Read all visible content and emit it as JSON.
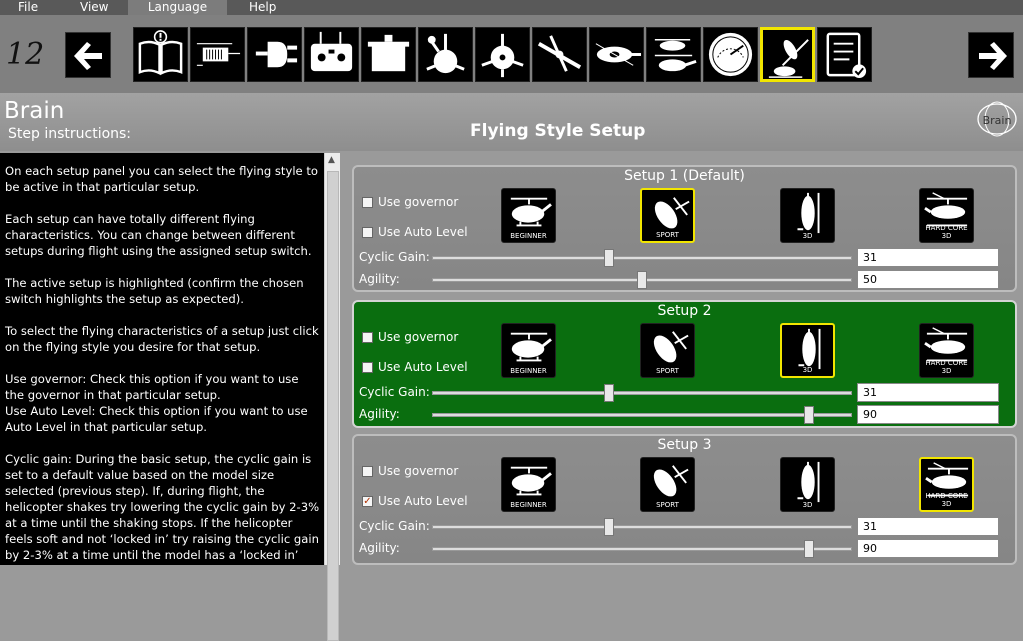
{
  "menu": [
    "File",
    "View",
    "Language",
    "Help"
  ],
  "menu_active": "Language",
  "toolbar": {
    "step_number": "12",
    "step_icons": [
      "manual-book-icon",
      "receiver-icon",
      "plug-icon",
      "transmitter-icon",
      "servo-icon",
      "swashplate-icon",
      "swashplate-level-icon",
      "rotor-blades-icon",
      "helicopter-top-icon",
      "helicopter-tilt-icon",
      "gauge-icon",
      "flying-style-icon",
      "checklist-icon"
    ],
    "selected_step": 11
  },
  "header": {
    "app_title": "Brain",
    "step_label": "Step instructions:",
    "page_title": "Flying Style Setup",
    "logo_text": "Brain"
  },
  "instructions": [
    "On each setup panel you can select the flying style to be active in that particular setup.",
    "Each setup can have totally different flying characteristics. You can change between different setups during flight using the assigned setup switch.",
    "The active setup is highlighted (confirm the chosen switch highlights the setup as expected).",
    "To select the flying characteristics of a setup just click on the flying style you desire for that setup.",
    "Use governor: Check this option if you want to use the governor in that particular setup.\nUse Auto Level: Check this option if you want to use Auto Level in that particular setup.",
    "Cyclic gain: During the basic setup, the cyclic gain is set to a default value based on the model size selected (previous step). If, during flight, the helicopter shakes try lowering the cyclic gain by 2-3% at a time until the shaking stops. If the helicopter feels soft and not ‘locked in’ try raising the cyclic gain by 2-3% at a time until the model has a ‘locked in’ feel."
  ],
  "labels": {
    "use_governor": "Use governor",
    "use_auto_level": "Use Auto Level",
    "cyclic_gain": "Cyclic Gain:",
    "agility": "Agility:"
  },
  "styles": [
    "BEGINNER",
    "SPORT",
    "3D",
    "HARD CORE 3D"
  ],
  "setups": [
    {
      "title": "Setup 1 (Default)",
      "active": false,
      "use_governor": false,
      "use_auto_level": false,
      "selected_style": 1,
      "cyclic_gain": "31",
      "agility": "50",
      "cyclic_gain_pos": 0.42,
      "agility_pos": 0.5
    },
    {
      "title": "Setup 2",
      "active": true,
      "use_governor": false,
      "use_auto_level": false,
      "selected_style": 2,
      "cyclic_gain": "31",
      "agility": "90",
      "cyclic_gain_pos": 0.42,
      "agility_pos": 0.9
    },
    {
      "title": "Setup 3",
      "active": false,
      "use_governor": false,
      "use_auto_level": true,
      "selected_style": 3,
      "cyclic_gain": "31",
      "agility": "90",
      "cyclic_gain_pos": 0.42,
      "agility_pos": 0.9
    }
  ],
  "colors": {
    "active_panel": "#0a6e0f",
    "highlight": "#f2e600"
  }
}
